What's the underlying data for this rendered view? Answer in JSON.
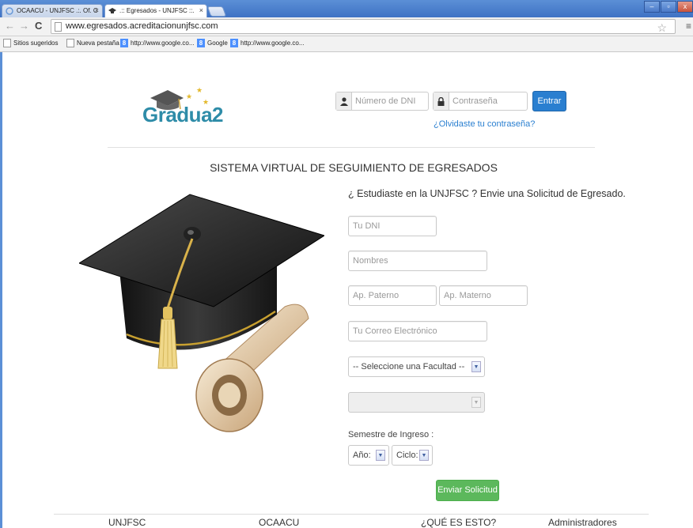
{
  "browser": {
    "tabs": [
      {
        "title": "OCAACU - UNJFSC .:. Of. C",
        "active": false
      },
      {
        "title": ".:: Egresados - UNJFSC ::.",
        "active": true
      }
    ],
    "url": "www.egresados.acreditacionunjfsc.com",
    "bookmarks": [
      {
        "label": "Sitios sugeridos",
        "icon": "page-icon"
      },
      {
        "label": "Nueva pestaña",
        "icon": "page-icon"
      },
      {
        "label": "http://www.google.co...",
        "icon": "google-icon"
      },
      {
        "label": "Google",
        "icon": "google-icon"
      },
      {
        "label": "http://www.google.co...",
        "icon": "google-icon"
      }
    ]
  },
  "logo": {
    "text": "Gradua",
    "digit": "2"
  },
  "login": {
    "dni_placeholder": "Número de DNI",
    "password_placeholder": "Contraseña",
    "submit_label": "Entrar",
    "forgot_label": "¿Olvidaste tu contraseña?"
  },
  "page_title": "SISTEMA VIRTUAL DE SEGUIMIENTO DE EGRESADOS",
  "form": {
    "title": "¿ Estudiaste en la UNJFSC ? Envie una Solicitud de Egresado.",
    "dni_placeholder": "Tu DNI",
    "nombres_placeholder": "Nombres",
    "ap_paterno_placeholder": "Ap. Paterno",
    "ap_materno_placeholder": "Ap. Materno",
    "correo_placeholder": "Tu Correo Electrónico",
    "facultad_select": "-- Seleccione una Facultad --",
    "escuela_select": "",
    "semestre_label": "Semestre de Ingreso :",
    "anio_select": "Año:",
    "ciclo_select": "Ciclo:",
    "submit_label": "Enviar Solicitud"
  },
  "footer": [
    "UNJFSC",
    "OCAACU",
    "¿QUÉ ES ESTO?",
    "Administradores"
  ],
  "colors": {
    "primary": "#2a7fd0",
    "success": "#5cb85c",
    "logo": "#2e8ca8"
  }
}
